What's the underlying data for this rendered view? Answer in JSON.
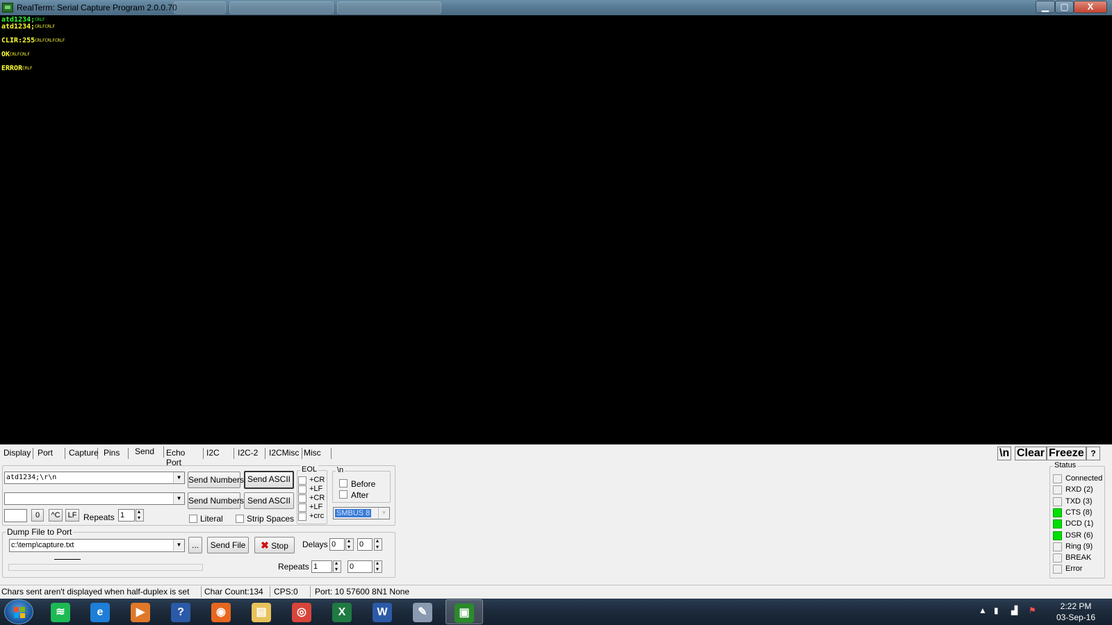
{
  "window": {
    "title": "RealTerm: Serial Capture Program 2.0.0.70",
    "minimize": "▁",
    "maximize": "▢",
    "close": "X"
  },
  "terminal": {
    "lines": [
      {
        "text": "atd1234;",
        "ctl": "CRLF",
        "color": "green"
      },
      {
        "text": "atd1234;",
        "ctl": "CRLFCRLF",
        "color": "yellow"
      },
      {
        "text": "",
        "ctl": "",
        "color": "yellow"
      },
      {
        "text": "CLIR:255",
        "ctl": "CRLFCRLFCRLF",
        "color": "yellow"
      },
      {
        "text": "",
        "ctl": "",
        "color": "yellow"
      },
      {
        "text": "OK",
        "ctl": "CRLFCRLF",
        "color": "yellow"
      },
      {
        "text": "",
        "ctl": "",
        "color": "yellow"
      },
      {
        "text": "ERROR",
        "ctl": "CRLF",
        "color": "yellow"
      }
    ]
  },
  "tabs": [
    "Display",
    "Port",
    "Capture",
    "Pins",
    "Send",
    "Echo Port",
    "I2C",
    "I2C-2",
    "I2CMisc",
    "Misc"
  ],
  "active_tab": "Send",
  "right_buttons": {
    "newline": "\\n",
    "clear": "Clear",
    "freeze": "Freeze",
    "help": "?"
  },
  "send": {
    "line1_value": "atd1234;\\r\\n",
    "line2_value": "",
    "send_numbers": "Send Numbers",
    "send_ascii": "Send ASCII",
    "eol_title": "EOL",
    "eol_options": [
      "+CR",
      "+LF",
      "+CR",
      "+LF",
      "+crc"
    ],
    "nl_title": "\\n",
    "before": "Before",
    "after": "After",
    "smbus_value": "SMBUS 8",
    "char_value": "",
    "zero_btn": "0",
    "ctrl_c": "^C",
    "lf_btn": "LF",
    "repeats_label": "Repeats",
    "repeats_value": "1",
    "literal": "Literal",
    "strip_spaces": "Strip Spaces"
  },
  "dump": {
    "title": "Dump File to Port",
    "file": "c:\\temp\\capture.txt",
    "browse": "...",
    "send_file": "Send File",
    "stop": "Stop",
    "delays_label": "Delays",
    "delay1": "0",
    "delay2": "0",
    "repeats_label": "Repeats",
    "repeats1": "1",
    "repeats2": "0"
  },
  "status_panel": {
    "title": "Status",
    "items": [
      {
        "label": "Connected",
        "on": false
      },
      {
        "label": "RXD (2)",
        "on": false
      },
      {
        "label": "TXD (3)",
        "on": false
      },
      {
        "label": "CTS (8)",
        "on": true
      },
      {
        "label": "DCD (1)",
        "on": true
      },
      {
        "label": "DSR (6)",
        "on": true
      },
      {
        "label": "Ring (9)",
        "on": false
      },
      {
        "label": "BREAK",
        "on": false
      },
      {
        "label": "Error",
        "on": false
      }
    ],
    "on_color": "#00e000"
  },
  "statusbar": {
    "message": "Chars sent aren't displayed when half-duplex is set",
    "char_count": "Char Count:134",
    "cps": "CPS:0",
    "port": "Port: 10 57600 8N1 None"
  },
  "taskbar": {
    "apps": [
      {
        "icon": "spotify-icon",
        "glyph": "≋",
        "color": "#1db954"
      },
      {
        "icon": "internet-explorer-icon",
        "glyph": "e",
        "color": "#1e7ed8"
      },
      {
        "icon": "media-player-icon",
        "glyph": "▶",
        "color": "#e0782a"
      },
      {
        "icon": "help-icon",
        "glyph": "?",
        "color": "#2a5aa8"
      },
      {
        "icon": "firefox-icon",
        "glyph": "◉",
        "color": "#e8671f"
      },
      {
        "icon": "file-explorer-icon",
        "glyph": "▤",
        "color": "#e8c25a"
      },
      {
        "icon": "chrome-icon",
        "glyph": "◎",
        "color": "#d9443a"
      },
      {
        "icon": "excel-icon",
        "glyph": "X",
        "color": "#1f7a43"
      },
      {
        "icon": "word-icon",
        "glyph": "W",
        "color": "#2b5aa8"
      },
      {
        "icon": "paint-icon",
        "glyph": "✎",
        "color": "#8a9ab0"
      },
      {
        "icon": "realterm-icon",
        "glyph": "▣",
        "color": "#2b8a2b"
      }
    ],
    "time": "2:22 PM",
    "date": "03-Sep-16"
  }
}
